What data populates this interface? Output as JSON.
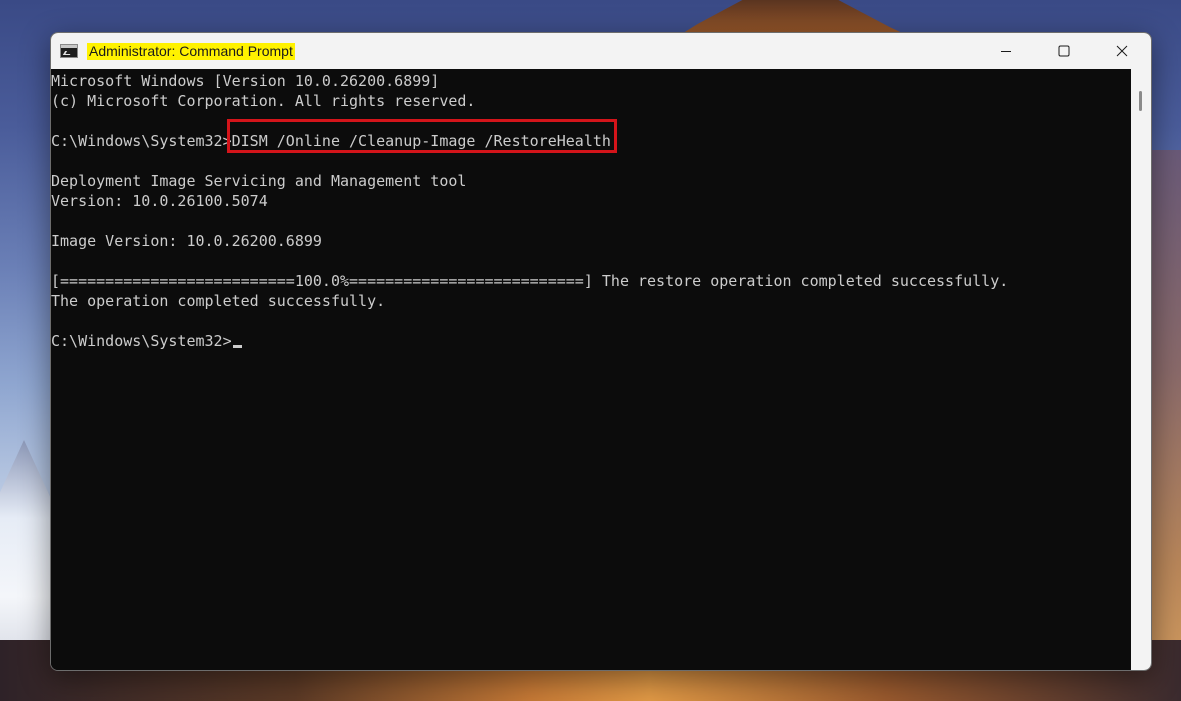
{
  "window": {
    "title": "Administrator: Command Prompt",
    "highlight_color": "#fff200",
    "annotation_color": "#d4141a"
  },
  "caption": {
    "minimize": "minimize-icon",
    "maximize": "maximize-icon",
    "close": "close-icon"
  },
  "console": {
    "header_line1": "Microsoft Windows [Version 10.0.26200.6899]",
    "header_line2": "(c) Microsoft Corporation. All rights reserved.",
    "prompt1": "C:\\Windows\\System32>",
    "command": "DISM /Online /Cleanup-Image /RestoreHealth",
    "tool_name": "Deployment Image Servicing and Management tool",
    "tool_version": "Version: 10.0.26100.5074",
    "image_version": "Image Version: 10.0.26200.6899",
    "progress_line": "[==========================100.0%==========================] The restore operation completed successfully.",
    "result": "The operation completed successfully.",
    "prompt2": "C:\\Windows\\System32>"
  }
}
